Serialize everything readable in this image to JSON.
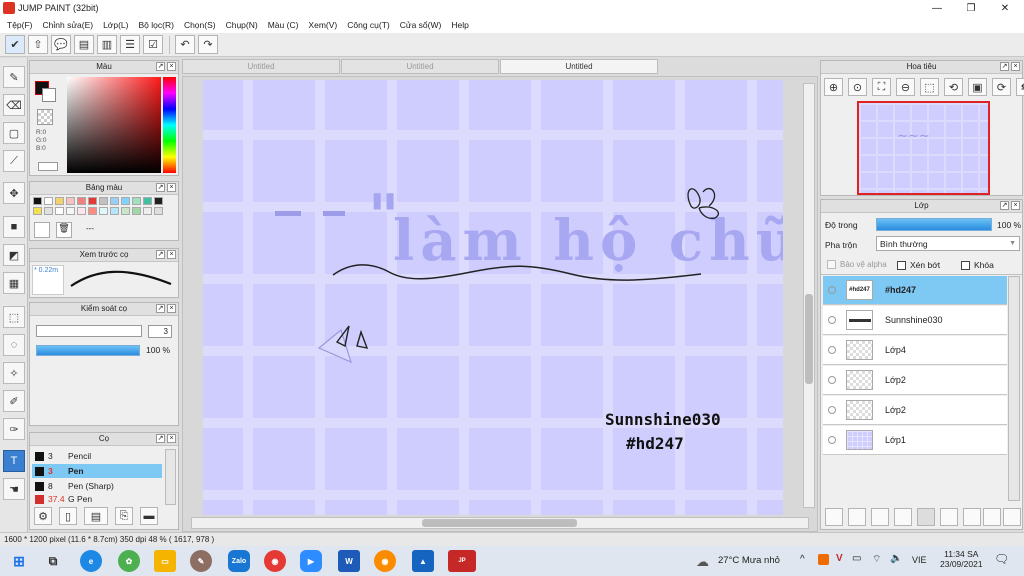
{
  "window": {
    "title": "JUMP PAINT (32bit)",
    "controls": [
      "—",
      "❐",
      "✕"
    ]
  },
  "menu": [
    "Tệp(F)",
    "Chỉnh sửa(E)",
    "Lớp(L)",
    "Bộ lọc(R)",
    "Chọn(S)",
    "Chụp(N)",
    "Màu (C)",
    "Xem(V)",
    "Công cụ(T)",
    "Cửa sổ(W)",
    "Help"
  ],
  "tabs": [
    "Untitled",
    "Untitled",
    "Untitled"
  ],
  "panels": {
    "color": {
      "title": "Màu",
      "r": "R:0",
      "g": "G:0",
      "b": "B:0"
    },
    "palette": {
      "title": "Bảng màu",
      "colors": [
        "#111111",
        "#ffffff",
        "#f3d36a",
        "#f7c1c1",
        "#f08080",
        "#e53935",
        "#c0c0c0",
        "#9ad0f5",
        "#80d4ff",
        "#a0e0c0",
        "#40c0a0",
        "#202020"
      ],
      "more": "---"
    },
    "brush_preview": {
      "title": "Xem trước cọ",
      "size": "0.22m"
    },
    "brush_control": {
      "title": "Kiểm soát cọ",
      "size": "3",
      "opacity": "100 %"
    },
    "brushes": {
      "title": "Cọ",
      "items": [
        {
          "size": "3",
          "name": "Pencil",
          "selected": false,
          "color": "#111111"
        },
        {
          "size": "3",
          "name": "Pen",
          "selected": true,
          "color": "#111111"
        },
        {
          "size": "8",
          "name": "Pen (Sharp)",
          "selected": false,
          "color": "#111111"
        },
        {
          "size": "37.4",
          "name": "G Pen",
          "selected": false,
          "color": "#d32f2f"
        }
      ]
    },
    "navigator": {
      "title": "Hoa tiêu"
    },
    "layers": {
      "title": "Lớp",
      "opacity_label": "Độ trong",
      "opacity_value": "100 %",
      "opacity_fraction": 1.0,
      "blend_label": "Pha trộn",
      "blend_value": "Bình thường",
      "protect_alpha": "Bảo vệ alpha",
      "clipping": "Xén bớt",
      "lock": "Khóa",
      "items": [
        {
          "name": "#hd247",
          "thumb_text": "#hd247",
          "selected": true
        },
        {
          "name": "Sunnshine030",
          "thumb_text": "",
          "selected": false
        },
        {
          "name": "Lớp4",
          "thumb_text": "",
          "selected": false
        },
        {
          "name": "Lớp2",
          "thumb_text": "",
          "selected": false
        },
        {
          "name": "Lớp2",
          "thumb_text": "",
          "selected": false
        },
        {
          "name": "Lớp1",
          "thumb_text": "",
          "selected": false
        }
      ]
    }
  },
  "artwork": {
    "title_text": "làm hộ chữ",
    "quote_mark": "\"",
    "signature_line1": "Sunnshine030",
    "signature_line2": "#hd247"
  },
  "status": "1600 * 1200 pixel  (11.6 * 8.7cm)  350 dpi  48 %  ( 1617, 978 )",
  "taskbar": {
    "weather": "27°C  Mưa nhỏ",
    "language": "VIE",
    "time": "11:34 SA",
    "date": "23/09/2021"
  },
  "colors": {
    "accent": "#3a7fd0",
    "artwork_bg": "#c9c8fc",
    "layer_selected": "#7ec8f4"
  }
}
